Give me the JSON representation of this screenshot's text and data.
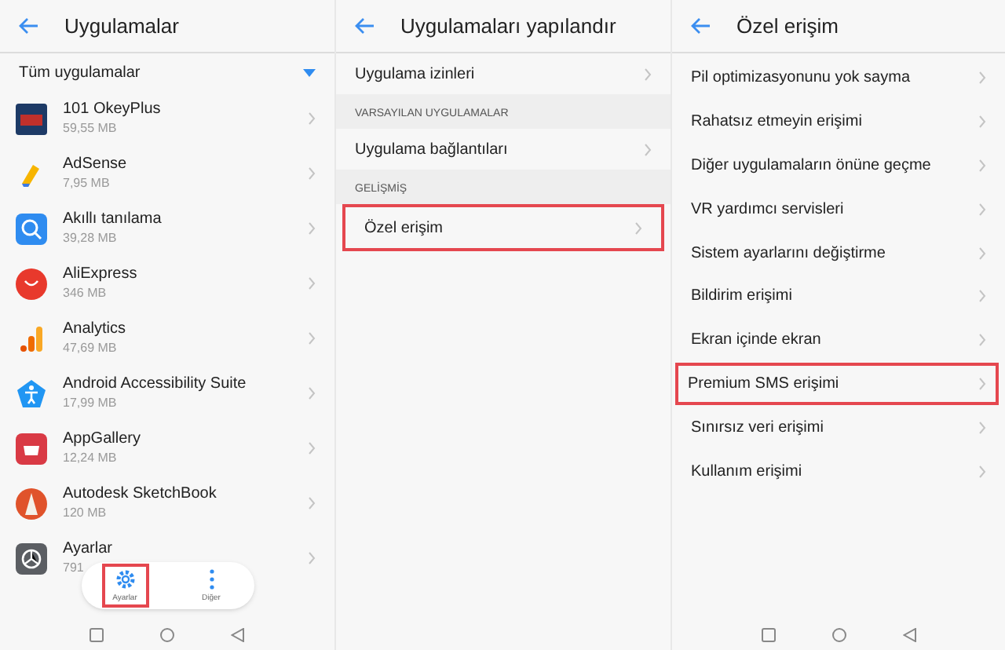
{
  "apps_screen": {
    "title": "Uygulamalar",
    "filter": "Tüm uygulamalar",
    "apps": [
      {
        "name": "101 OkeyPlus",
        "size": "59,55 MB"
      },
      {
        "name": "AdSense",
        "size": "7,95 MB"
      },
      {
        "name": "Akıllı tanılama",
        "size": "39,28 MB"
      },
      {
        "name": "AliExpress",
        "size": "346 MB"
      },
      {
        "name": "Analytics",
        "size": "47,69 MB"
      },
      {
        "name": "Android Accessibility Suite",
        "size": "17,99 MB"
      },
      {
        "name": "AppGallery",
        "size": "12,24 MB"
      },
      {
        "name": "Autodesk SketchBook",
        "size": "120 MB"
      },
      {
        "name": "Ayarlar",
        "size": "791"
      }
    ],
    "bottom_actions": [
      {
        "kind": "settings",
        "label": "Ayarlar",
        "highlighted": true
      },
      {
        "kind": "more",
        "label": "Diğer",
        "highlighted": false
      }
    ]
  },
  "configure_screen": {
    "title": "Uygulamaları yapılandır",
    "items": [
      {
        "kind": "item",
        "label": "Uygulama izinleri",
        "highlighted": false
      },
      {
        "kind": "section",
        "label": "VARSAYILAN UYGULAMALAR"
      },
      {
        "kind": "item",
        "label": "Uygulama bağlantıları",
        "highlighted": false
      },
      {
        "kind": "section",
        "label": "GELİŞMİŞ"
      },
      {
        "kind": "item",
        "label": "Özel erişim",
        "highlighted": true
      }
    ]
  },
  "special_access_screen": {
    "title": "Özel erişim",
    "items": [
      {
        "label": "Pil optimizasyonunu yok sayma",
        "highlighted": false
      },
      {
        "label": "Rahatsız etmeyin erişimi",
        "highlighted": false
      },
      {
        "label": "Diğer uygulamaların önüne geçme",
        "highlighted": false
      },
      {
        "label": "VR yardımcı servisleri",
        "highlighted": false
      },
      {
        "label": "Sistem ayarlarını değiştirme",
        "highlighted": false
      },
      {
        "label": "Bildirim erişimi",
        "highlighted": false
      },
      {
        "label": "Ekran içinde ekran",
        "highlighted": false
      },
      {
        "label": "Premium SMS erişimi",
        "highlighted": true
      },
      {
        "label": "Sınırsız veri erişimi",
        "highlighted": false
      },
      {
        "label": "Kullanım erişimi",
        "highlighted": false
      }
    ]
  }
}
